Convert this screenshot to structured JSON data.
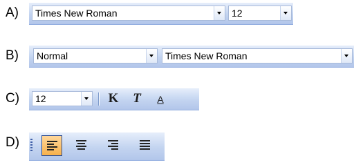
{
  "rows": [
    {
      "label": "A)",
      "font_combo": {
        "value": "Times New Roman"
      },
      "size_combo": {
        "value": "12"
      }
    },
    {
      "label": "B)",
      "style_combo": {
        "value": "Normal"
      },
      "font_combo": {
        "value": "Times New Roman"
      }
    },
    {
      "label": "C)",
      "size_combo": {
        "value": "12"
      },
      "buttons": [
        {
          "name": "bold",
          "glyph": "K",
          "icon": "bold-icon"
        },
        {
          "name": "italic",
          "glyph": "T",
          "icon": "italic-icon"
        },
        {
          "name": "font-color",
          "glyph": "A",
          "icon": "font-color-icon"
        }
      ]
    },
    {
      "label": "D)",
      "buttons": [
        {
          "name": "align-left",
          "icon": "align-left-icon",
          "active": true
        },
        {
          "name": "align-center",
          "icon": "align-center-icon",
          "active": false
        },
        {
          "name": "align-right",
          "icon": "align-right-icon",
          "active": false
        },
        {
          "name": "justify",
          "icon": "justify-icon",
          "active": false
        }
      ]
    }
  ],
  "colors": {
    "toolbar_top": "#e6eefb",
    "toolbar_bottom": "#b2c6ea",
    "active_button": "#f7b14b",
    "active_border": "#2a4c93"
  }
}
